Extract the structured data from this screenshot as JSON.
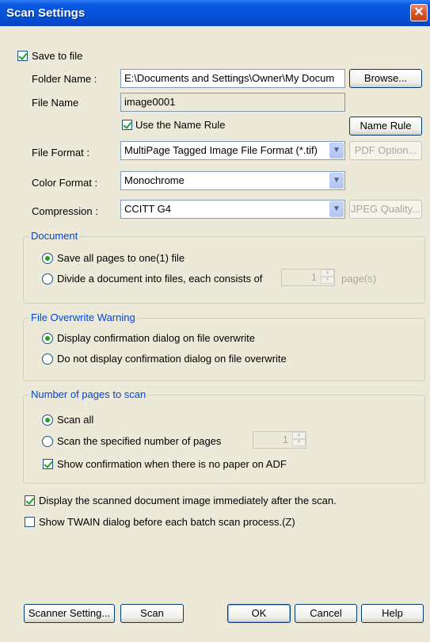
{
  "window": {
    "title": "Scan Settings"
  },
  "save_to_file": {
    "label": "Save to file",
    "checked": true,
    "folder_label": "Folder Name :",
    "folder_value": "E:\\Documents and Settings\\Owner\\My Docum",
    "browse_label": "Browse...",
    "file_label": "File Name",
    "file_value": "image0001",
    "use_name_rule_label": "Use the Name Rule",
    "use_name_rule_checked": true,
    "name_rule_label": "Name Rule",
    "file_format_label": "File Format :",
    "file_format_value": "MultiPage Tagged Image File Format (*.tif)",
    "pdf_option_label": "PDF Option...",
    "color_format_label": "Color Format :",
    "color_format_value": "Monochrome",
    "compression_label": "Compression :",
    "compression_value": "CCITT G4",
    "jpeg_quality_label": "JPEG Quality..."
  },
  "document": {
    "title": "Document",
    "option_save_all": "Save all pages to one(1) file",
    "option_divide": "Divide a document into files, each consists of",
    "pages_value": "1",
    "pages_label": "page(s)",
    "selected": "save_all"
  },
  "overwrite": {
    "title": "File Overwrite Warning",
    "option_display": "Display confirmation dialog on file overwrite",
    "option_no_display": "Do not display confirmation dialog on file overwrite",
    "selected": "display"
  },
  "pages_to_scan": {
    "title": "Number of pages to scan",
    "option_all": "Scan all",
    "option_specified": "Scan the specified number of pages",
    "count_value": "1",
    "show_confirmation_label": "Show confirmation when there is no paper on ADF",
    "show_confirmation_checked": true,
    "selected": "all"
  },
  "options": {
    "display_image_label": "Display the scanned document image immediately after the scan.",
    "display_image_checked": true,
    "show_twain_label": "Show TWAIN dialog before each batch scan process.(Z)",
    "show_twain_checked": false
  },
  "buttons": {
    "scanner_setting": "Scanner Setting...",
    "scan": "Scan",
    "ok": "OK",
    "cancel": "Cancel",
    "help": "Help"
  },
  "colors": {
    "title_bar": "#0553d8",
    "dialog_bg": "#ece9d8",
    "group_title": "#0046d5",
    "check_mark": "#21a121"
  }
}
